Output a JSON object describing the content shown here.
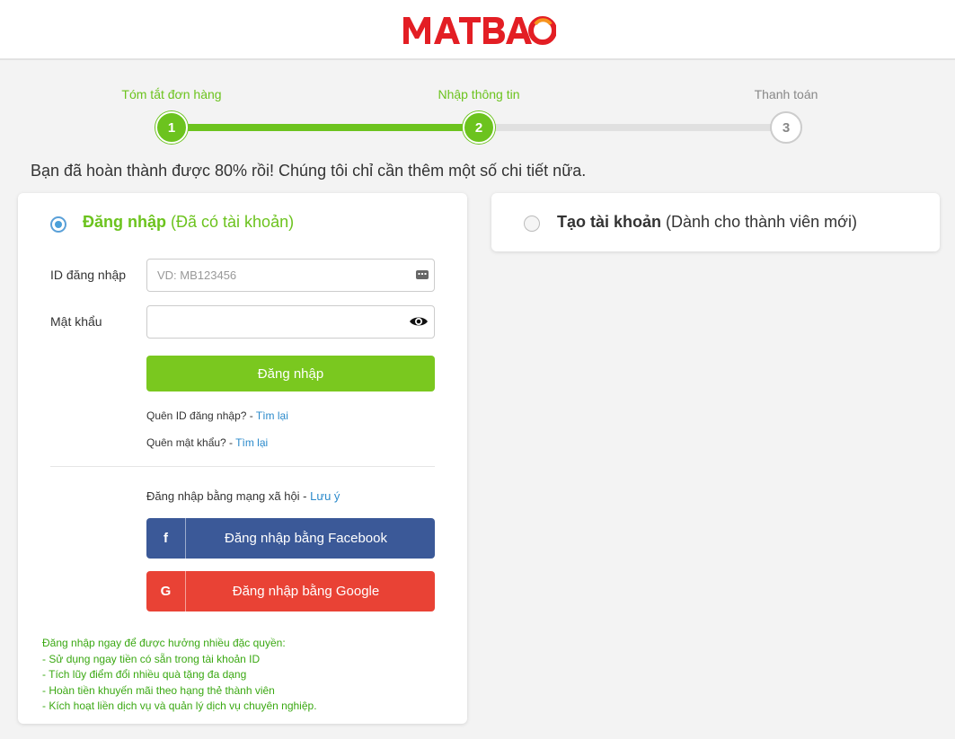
{
  "brand": {
    "name": "MATBAO",
    "colors": {
      "red": "#e31e24",
      "green": "#6cc31e",
      "blue": "#3b5998",
      "google": "#e94235"
    }
  },
  "steps": [
    {
      "number": "1",
      "label": "Tóm tắt đơn hàng",
      "status": "done"
    },
    {
      "number": "2",
      "label": "Nhập thông tin",
      "status": "current"
    },
    {
      "number": "3",
      "label": "Thanh toán",
      "status": "todo"
    }
  ],
  "progress_message": "Bạn đã hoàn thành được 80% rồi! Chúng tôi chỉ cần thêm một số chi tiết nữa.",
  "login": {
    "title": "Đăng nhập",
    "subtitle": "(Đã có tài khoản)",
    "id_label": "ID đăng nhập",
    "id_placeholder": "VD: MB123456",
    "id_value": "",
    "password_label": "Mật khẩu",
    "password_value": "",
    "submit_label": "Đăng nhập",
    "forgot_id_text": "Quên ID đăng nhập? - ",
    "forgot_id_link": "Tìm lại",
    "forgot_pw_text": "Quên mật khẩu? - ",
    "forgot_pw_link": "Tìm lại",
    "social_title": "Đăng nhập bằng mạng xã hội - ",
    "social_note_link": "Lưu ý",
    "facebook_icon": "f",
    "facebook_label": "Đăng nhập bằng Facebook",
    "google_icon": "G",
    "google_label": "Đăng nhập bằng Google",
    "benefits_title": "Đăng nhập ngay để được hưởng nhiều đặc quyền:",
    "benefits": [
      "- Sử dụng ngay tiền có sẵn trong tài khoản ID",
      "- Tích lũy điểm đổi nhiều quà tặng đa dạng",
      "- Hoàn tiền khuyến mãi theo hạng thẻ thành viên",
      "- Kích hoạt liền dịch vụ và quản lý dịch vụ chuyên nghiệp."
    ]
  },
  "register": {
    "title": "Tạo tài khoản",
    "subtitle": "(Dành cho thành viên mới)"
  }
}
